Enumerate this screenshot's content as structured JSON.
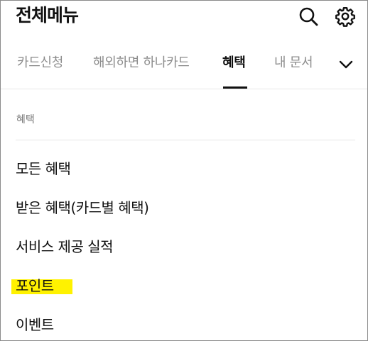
{
  "header": {
    "title": "전체메뉴",
    "search_icon": "search-icon",
    "settings_icon": "gear-icon"
  },
  "tabs": [
    {
      "label": "카드신청",
      "active": false
    },
    {
      "label": "해외하면 하나카드",
      "active": false
    },
    {
      "label": "혜택",
      "active": true
    },
    {
      "label": "내 문서",
      "active": false
    }
  ],
  "tabs_more_icon": "chevron-down-icon",
  "section": {
    "title": "혜택",
    "items": [
      {
        "label": "모든 혜택"
      },
      {
        "label": "받은 혜택(카드별 혜택)"
      },
      {
        "label": "서비스 제공 실적"
      },
      {
        "label": "포인트",
        "highlighted": true
      },
      {
        "label": "이벤트"
      }
    ]
  },
  "colors": {
    "highlight": "#fff200",
    "text": "#111111",
    "inactive_tab": "#8c8c8c",
    "divider": "#e6e6e6"
  }
}
